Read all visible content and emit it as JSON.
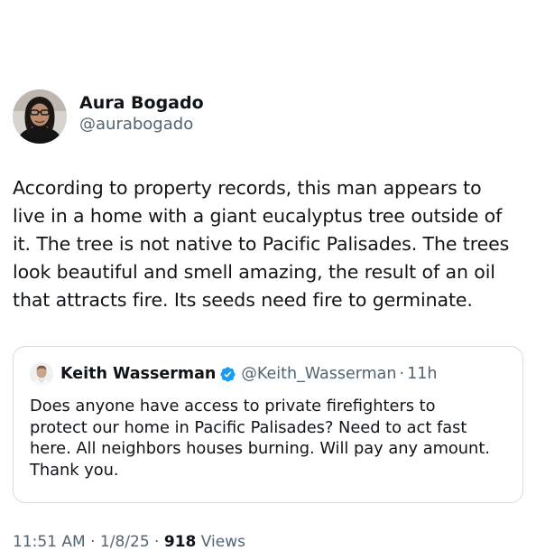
{
  "author": {
    "name": "Aura Bogado",
    "handle": "@aurabogado",
    "avatar_icon": "profile-photo-icon"
  },
  "tweet": {
    "text": "According to property records, this man appears to\nlive in a home with a giant eucalyptus tree outside of\nit. The tree is not native to Pacific Palisades. The trees\nlook beautiful and smell amazing, the result of an oil\nthat attracts fire. Its seeds need fire to germinate."
  },
  "quoted_tweet": {
    "name": "Keith Wasserman",
    "handle": "@Keith_Wasserman",
    "separator": "·",
    "time": "11h",
    "verified_icon": "verified-badge-icon",
    "text": "Does anyone have access to private firefighters to\nprotect our home in Pacific Palisades? Need to act fast\nhere. All neighbors houses burning. Will pay any amount.\nThank you."
  },
  "meta": {
    "time": "11:51 AM",
    "separator": "·",
    "date": "1/8/25",
    "views_count": "918",
    "views_label": "Views"
  },
  "colors": {
    "text_primary": "#0f1419",
    "text_secondary": "#536471",
    "verified_blue": "#1d9bf0",
    "card_border": "#d6dbdf"
  }
}
